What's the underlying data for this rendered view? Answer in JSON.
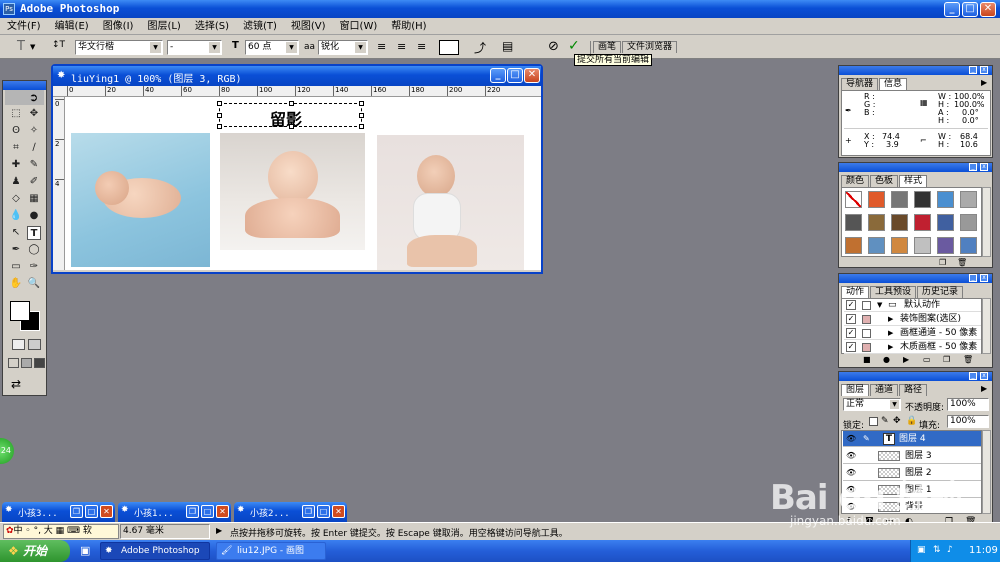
{
  "app": {
    "title": "Adobe Photoshop"
  },
  "menu": [
    "文件(F)",
    "编辑(E)",
    "图像(I)",
    "图层(L)",
    "选择(S)",
    "滤镜(T)",
    "视图(V)",
    "窗口(W)",
    "帮助(H)"
  ],
  "options": {
    "tool_glyph": "T",
    "orientation_glyph": "↕T",
    "font_family": "华文行楷",
    "font_style": "-",
    "font_size": "60 点",
    "aa_label": "aa",
    "antialias": "锐化",
    "commit_tooltip": "提交所有当前编辑",
    "tabs": [
      "画笔",
      "文件浏览器"
    ]
  },
  "document": {
    "title": "liuYing1 @ 100% (图层 3, RGB)",
    "ruler": [
      "0",
      "20",
      "40",
      "60",
      "80",
      "100",
      "120",
      "140",
      "160",
      "180",
      "200",
      "220"
    ],
    "text_layer": "留影",
    "vruler": [
      "0",
      "2",
      "4"
    ]
  },
  "info_panel": {
    "tabs": [
      "导航器",
      "信息"
    ],
    "r": "R :",
    "g": "G :",
    "b": "B :",
    "w1": "W :",
    "w1_val": "100.0%",
    "h1": "H :",
    "h1_val": "100.0%",
    "a": "A :",
    "a_val": "0.0°",
    "h2": "H :",
    "h2_val": "0.0°",
    "x": "X :",
    "x_val": "74.4",
    "y": "Y :",
    "y_val": "3.9",
    "w2": "W :",
    "w2_val": "68.4",
    "h3": "H :",
    "h3_val": "10.6"
  },
  "styles_panel": {
    "tabs": [
      "颜色",
      "色板",
      "样式"
    ]
  },
  "actions_panel": {
    "tabs": [
      "动作",
      "工具预设",
      "历史记录"
    ],
    "rows": [
      {
        "label": "默认动作",
        "level": 0
      },
      {
        "label": "装饰图案(选区)",
        "level": 1
      },
      {
        "label": "画框通道 - 50 像素",
        "level": 1
      },
      {
        "label": "木质画框 - 50 像素",
        "level": 1
      }
    ]
  },
  "layers_panel": {
    "tabs": [
      "图层",
      "通道",
      "路径"
    ],
    "blend": "正常",
    "opacity_label": "不透明度:",
    "opacity": "100%",
    "lock_label": "锁定:",
    "fill_label": "填充:",
    "fill": "100%",
    "layers": [
      {
        "name": "图层 4",
        "selected": true,
        "type": "text"
      },
      {
        "name": "图层 3",
        "selected": false,
        "type": "image"
      },
      {
        "name": "图层 2",
        "selected": false,
        "type": "image"
      },
      {
        "name": "图层 1",
        "selected": false,
        "type": "image"
      },
      {
        "name": "背景",
        "selected": false,
        "type": "image"
      }
    ]
  },
  "minimized_docs": [
    "小孩3...",
    "小孩1...",
    "小孩2..."
  ],
  "status": {
    "zoom": "4.67 毫米",
    "message": "点按并拖移可旋转。按 Enter 键提交。按 Escape 键取消。用空格键访问导航工具。"
  },
  "ime": {
    "text": "中 ◦ °, 大 ▦ ⌨ 软"
  },
  "taskbar": {
    "start": "开始",
    "items": [
      "Adobe Photoshop",
      "liu12.JPG - 画图"
    ],
    "clock": "11:09"
  },
  "badge": "24",
  "watermark": {
    "brand": "Bai du 经验",
    "url": "jingyan.baidu.com"
  }
}
